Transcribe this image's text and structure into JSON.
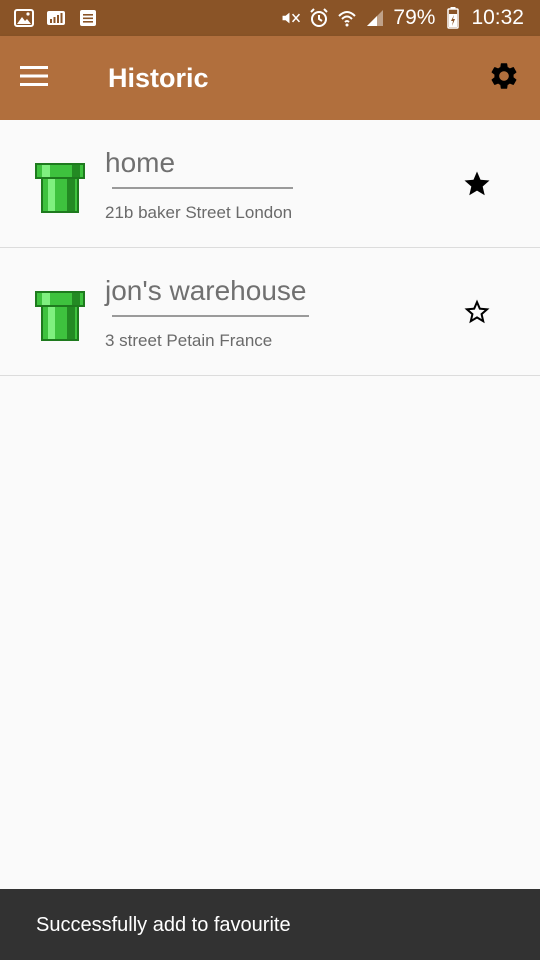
{
  "status_bar": {
    "left_icons": [
      "gallery-icon",
      "signal-bars-icon",
      "notes-icon"
    ],
    "right_icons": [
      "mute-icon",
      "alarm-icon",
      "wifi-icon",
      "cell-signal-icon"
    ],
    "battery": "79%",
    "time": "10:32"
  },
  "app_bar": {
    "title": "Historic",
    "menu_icon": "hamburger-menu-icon",
    "settings_icon": "gear-icon",
    "color": "#b16f3d",
    "status_color": "#8a5427"
  },
  "items": [
    {
      "name": "home",
      "address": "21b baker Street London",
      "favourite": true,
      "icon": "green-pipe-icon"
    },
    {
      "name": "jon's warehouse",
      "address": "3 street Petain France",
      "favourite": false,
      "icon": "green-pipe-icon"
    }
  ],
  "snackbar": {
    "message": "Successfully add to favourite"
  }
}
